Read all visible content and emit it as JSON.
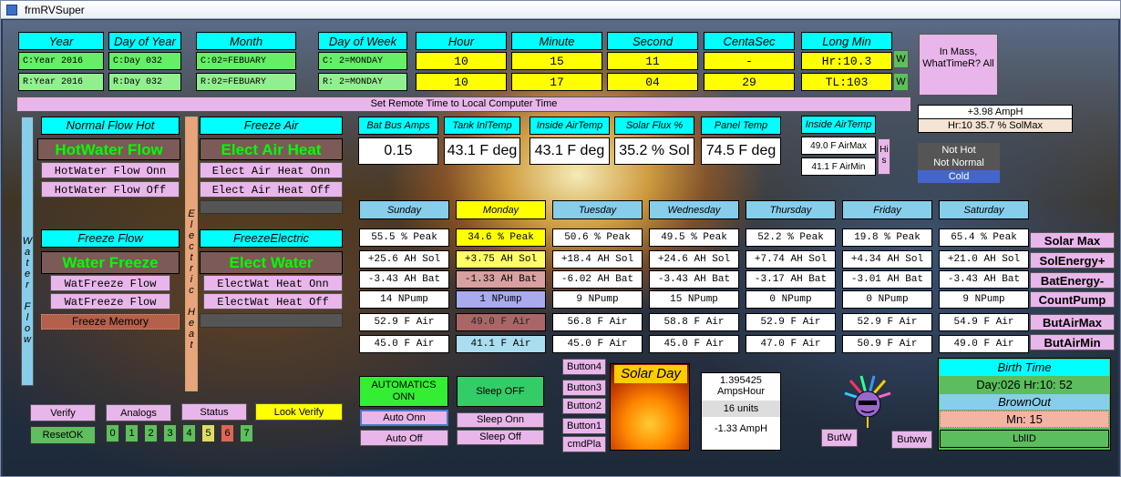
{
  "window": {
    "title": "frmRVSuper"
  },
  "time_headers": [
    "Year",
    "Day of Year",
    "Month",
    "Day of Week",
    "Hour",
    "Minute",
    "Second",
    "CentaSec",
    "Long Min"
  ],
  "local_row": [
    "C:Year 2016",
    "C:Day 032",
    "C:02=FEBUARY",
    "C: 2=MONDAY",
    "10",
    "15",
    "11",
    "-",
    "Hr:10.3"
  ],
  "remote_row": [
    "R:Year 2016",
    "R:Day 032",
    "R:02=FEBUARY",
    "R: 2=MONDAY",
    "10",
    "17",
    "04",
    "29",
    "TL:103"
  ],
  "w_buttons": [
    "W",
    "W"
  ],
  "mass_button": "In Mass, WhatTimeR? All",
  "set_remote_button": "Set Remote Time to Local Computer Time",
  "water": {
    "side_label": "Water Flow",
    "normal_flow_header": "Normal Flow Hot",
    "hotwater_flow": "HotWater Flow",
    "hotwater_on": "HotWater Flow Onn",
    "hotwater_off": "HotWater Flow Off",
    "freeze_flow_header": "Freeze Flow",
    "water_freeze": "Water Freeze",
    "watfreeze_1": "WatFreeze Flow",
    "watfreeze_2": "WatFreeze Flow",
    "freeze_memory": "Freeze Memory"
  },
  "electric": {
    "side_label": "Electric Heat",
    "freeze_air_header": "Freeze Air",
    "elect_air_heat": "Elect Air Heat",
    "elect_air_on": "Elect Air Heat Onn",
    "elect_air_off": "Elect Air Heat Off",
    "freeze_electric_header": "FreezeElectric",
    "elect_water": "Elect Water",
    "electwat_on": "ElectWat Heat Onn",
    "electwat_off": "ElectWat Heat Off"
  },
  "sensors": [
    {
      "label": "Bat Bus Amps",
      "value": "0.15"
    },
    {
      "label": "Tank InlTemp",
      "value": "43.1 F deg"
    },
    {
      "label": "Inside AirTemp",
      "value": "43.1 F deg"
    },
    {
      "label": "Solar Flux %",
      "value": "35.2 % Sol"
    },
    {
      "label": "Panel Temp",
      "value": "74.5 F deg"
    }
  ],
  "inside_air": {
    "label": "Inside AirTemp",
    "max": "49.0 F AirMax",
    "min": "41.1 F AirMin",
    "his": "His"
  },
  "amp_info": {
    "amph": "+3.98 AmpH",
    "solmax": "Hr:10  35.7 % SolMax"
  },
  "status_box": {
    "line1": "Not Hot",
    "line2": "Not Normal",
    "line3": "Cold"
  },
  "days": [
    "Sunday",
    "Monday",
    "Tuesday",
    "Wednesday",
    "Thursday",
    "Friday",
    "Saturday"
  ],
  "day_rows": [
    [
      "55.5 % Peak",
      "34.6 % Peak",
      "50.6 % Peak",
      "49.5 % Peak",
      "52.2 % Peak",
      "19.8 % Peak",
      "65.4 % Peak"
    ],
    [
      "+25.6 AH Sol",
      "+3.75 AH Sol",
      "+18.4 AH Sol",
      "+24.6 AH Sol",
      "+7.74 AH Sol",
      "+4.34 AH Sol",
      "+21.0 AH Sol"
    ],
    [
      "-3.43 AH Bat",
      "-1.33 AH Bat",
      "-6.02 AH Bat",
      "-3.43 AH Bat",
      "-3.17 AH Bat",
      "-3.01 AH Bat",
      "-3.43 AH Bat"
    ],
    [
      "14 NPump",
      "1 NPump",
      "9 NPump",
      "15 NPump",
      "0 NPump",
      "0 NPump",
      "9 NPump"
    ],
    [
      "52.9 F Air",
      "49.0 F Air",
      "56.8 F Air",
      "58.8 F Air",
      "52.9 F Air",
      "52.9 F Air",
      "54.9 F Air"
    ],
    [
      "45.0 F Air",
      "41.1 F Air",
      "45.0 F Air",
      "45.0 F Air",
      "47.0 F Air",
      "50.9 F Air",
      "49.0 F Air"
    ]
  ],
  "right_buttons": [
    "Solar Max",
    "SolEnergy+",
    "BatEnergy-",
    "CountPump",
    "ButAirMax",
    "ButAirMin"
  ],
  "bottom_left": {
    "verify": "Verify",
    "analogs": "Analogs",
    "status": "Status",
    "look_verify": "Look Verify",
    "reset_ok": "ResetOK",
    "digits": [
      "0",
      "1",
      "2",
      "3",
      "4",
      "5",
      "6",
      "7"
    ]
  },
  "automatics": {
    "label": "AUTOMATICS ONN",
    "auto_on": "Auto Onn",
    "auto_off": "Auto Off"
  },
  "sleep": {
    "label": "Sleep OFF",
    "sleep_on": "Sleep Onn",
    "sleep_off": "Sleep Off"
  },
  "small_buttons": [
    "Button4",
    "Button3",
    "Button2",
    "Button1",
    "cmdPla"
  ],
  "solar_day": "Solar Day",
  "amps_hour": {
    "value": "1.395425",
    "unit": "AmpsHour",
    "units": "16 units",
    "amph": "-1.33 AmpH"
  },
  "but_w": "ButW",
  "but_ww": "Butww",
  "birth": {
    "header": "Birth Time",
    "value": "Day:026  Hr:10: 52",
    "brownout": "BrownOut",
    "mn": "Mn: 15",
    "lblid": "LblID"
  },
  "colors": {
    "cyan": "#00ffff",
    "green": "#66ee66",
    "yellow": "#ffff00",
    "pink": "#e8b6ea",
    "sky": "#87ceeb",
    "brown": "#7b5a58"
  }
}
